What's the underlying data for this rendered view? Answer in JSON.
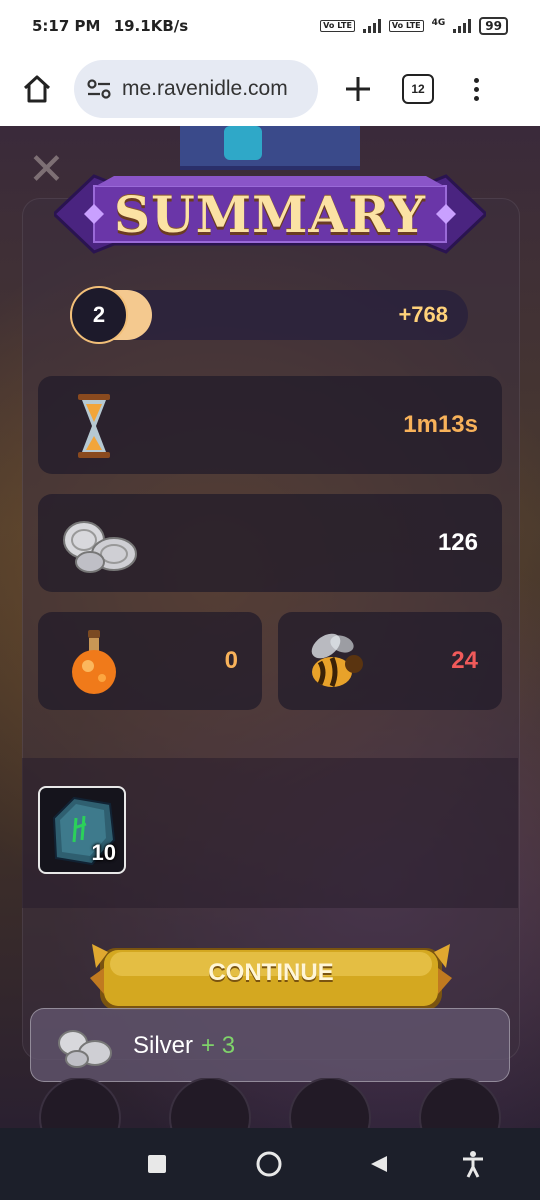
{
  "status_bar": {
    "time": "5:17 PM",
    "speed": "19.1KB/s",
    "volte1": "Vo LTE",
    "volte2": "Vo LTE",
    "network": "4G",
    "battery": "99"
  },
  "browser": {
    "url": "me.ravenidle.com",
    "tab_count": "12"
  },
  "summary": {
    "title": "SUMMARY",
    "level": "2",
    "xp_gain": "+768",
    "time": "1m13s",
    "silver": "126",
    "potion": "0",
    "bee": "24",
    "rune_count": "10",
    "continue_label": "CONTINUE"
  },
  "toast": {
    "item": "Silver",
    "gain": "+ 3"
  },
  "colors": {
    "gold": "#ffd27a",
    "orange": "#f8b25a",
    "red": "#f05a5a",
    "green": "#7fd36a",
    "banner_purple": "#5a2f91"
  }
}
